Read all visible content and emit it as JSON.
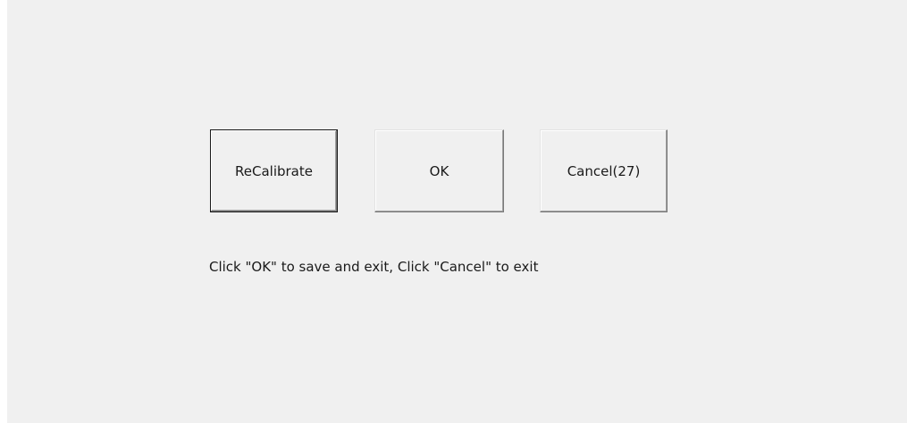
{
  "dialog": {
    "buttons": {
      "recalibrate_label": "ReCalibrate",
      "ok_label": "OK",
      "cancel_label": "Cancel(27)"
    },
    "message": "Click \"OK\" to save and exit, Click \"Cancel\" to exit"
  },
  "colors": {
    "background": "#f0f0f0",
    "button_face": "#f0f0f0",
    "text": "#1a1a1a"
  }
}
